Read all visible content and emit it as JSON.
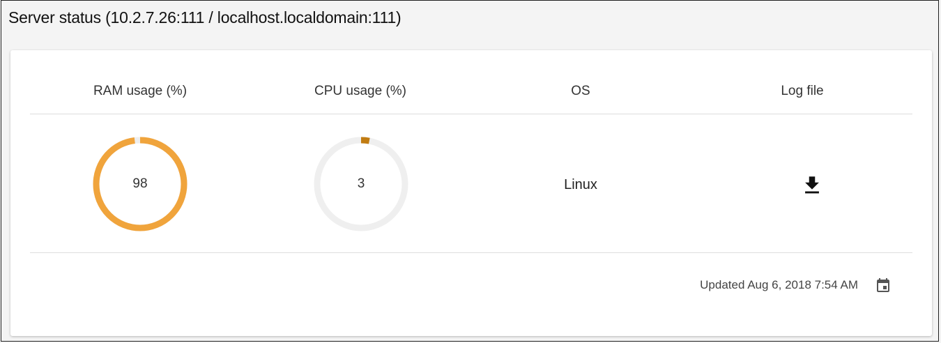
{
  "panel": {
    "title": "Server status (10.2.7.26:111 / localhost.localdomain:111)"
  },
  "columns": {
    "ram": {
      "header": "RAM usage (%)",
      "value": "98",
      "percent": 98,
      "color": "#f0a43c",
      "track_color": "#eeeeee"
    },
    "cpu": {
      "header": "CPU usage (%)",
      "value": "3",
      "percent": 3,
      "color": "#c17c12",
      "track_color": "#efefef"
    },
    "os": {
      "header": "OS",
      "value": "Linux"
    },
    "log": {
      "header": "Log file",
      "icon": "download-icon"
    }
  },
  "footer": {
    "updated_text": "Updated Aug 6, 2018 7:54 AM",
    "icon": "calendar-icon"
  }
}
